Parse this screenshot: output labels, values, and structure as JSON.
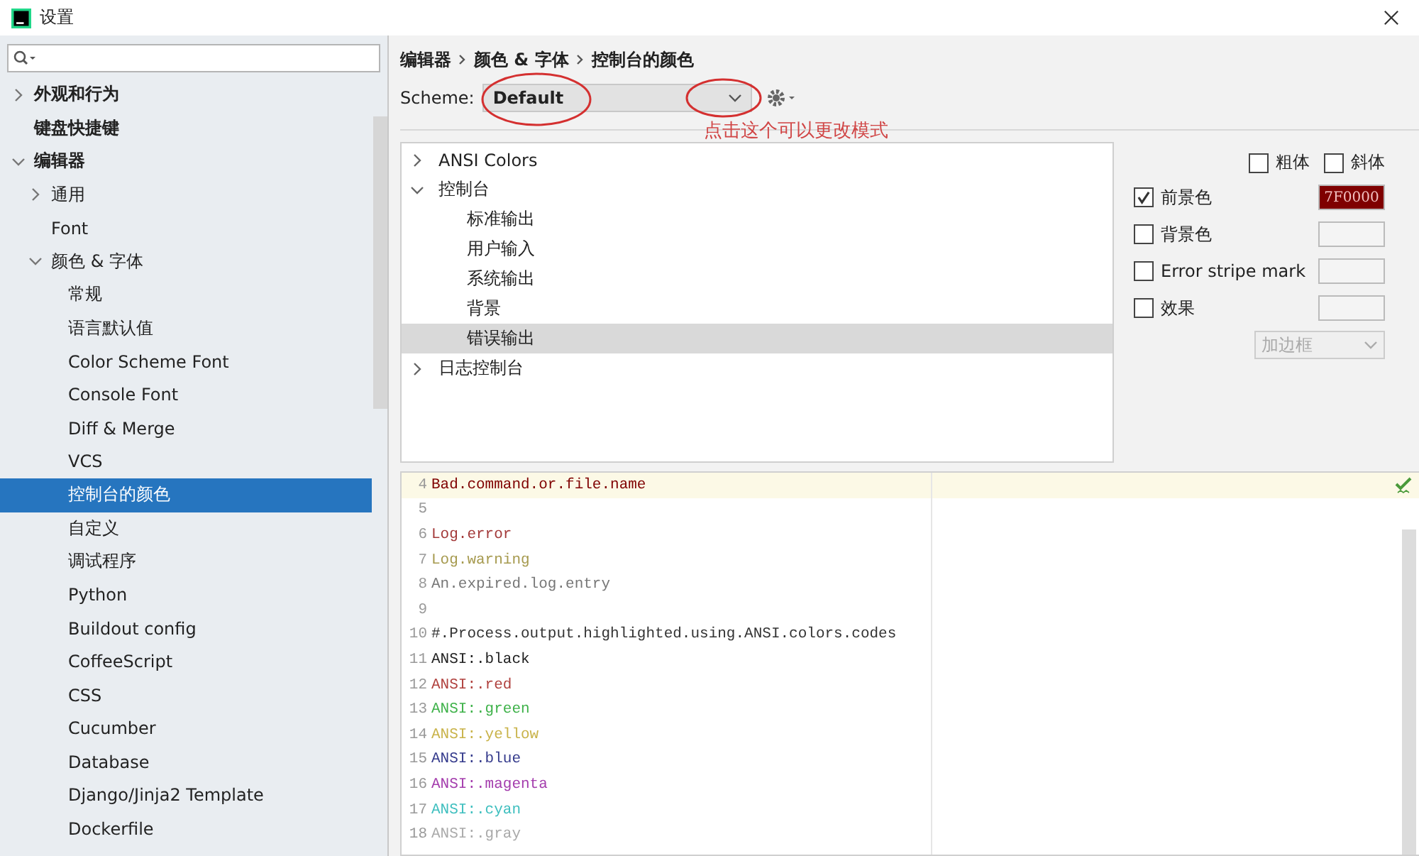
{
  "window": {
    "title": "设置"
  },
  "sidebar": {
    "items": [
      {
        "label": "外观和行为",
        "expanded": false,
        "selected": false
      },
      {
        "label": "键盘快捷键",
        "selected": false
      },
      {
        "label": "编辑器",
        "expanded": true,
        "selected": false,
        "children": [
          {
            "label": "通用",
            "expanded": false,
            "selected": false
          },
          {
            "label": "Font",
            "selected": false
          },
          {
            "label": "颜色 & 字体",
            "expanded": true,
            "selected": false,
            "children": [
              {
                "label": "常规",
                "selected": false
              },
              {
                "label": "语言默认值",
                "selected": false
              },
              {
                "label": "Color Scheme Font",
                "selected": false
              },
              {
                "label": "Console Font",
                "selected": false
              },
              {
                "label": "Diff & Merge",
                "selected": false
              },
              {
                "label": "VCS",
                "selected": false
              },
              {
                "label": "控制台的颜色",
                "selected": true
              },
              {
                "label": "自定义",
                "selected": false
              },
              {
                "label": "调试程序",
                "selected": false
              },
              {
                "label": "Python",
                "selected": false
              },
              {
                "label": "Buildout config",
                "selected": false
              },
              {
                "label": "CoffeeScript",
                "selected": false
              },
              {
                "label": "CSS",
                "selected": false
              },
              {
                "label": "Cucumber",
                "selected": false
              },
              {
                "label": "Database",
                "selected": false
              },
              {
                "label": "Django/Jinja2 Template",
                "selected": false
              },
              {
                "label": "Dockerfile",
                "selected": false
              }
            ]
          }
        ]
      }
    ]
  },
  "breadcrumb": [
    "编辑器",
    "颜色 & 字体",
    "控制台的颜色"
  ],
  "scheme": {
    "label": "Scheme:",
    "value": "Default"
  },
  "annotation": {
    "text": "点击这个可以更改模式"
  },
  "categories": [
    {
      "label": "ANSI Colors",
      "expanded": false,
      "selected": false
    },
    {
      "label": "控制台",
      "expanded": true,
      "selected": false,
      "children": [
        {
          "label": "标准输出",
          "selected": false
        },
        {
          "label": "用户输入",
          "selected": false
        },
        {
          "label": "系统输出",
          "selected": false
        },
        {
          "label": "背景",
          "selected": false
        },
        {
          "label": "错误输出",
          "selected": true
        }
      ]
    },
    {
      "label": "日志控制台",
      "expanded": false,
      "selected": false
    }
  ],
  "font_style": [
    {
      "label": "粗体",
      "checked": false
    },
    {
      "label": "斜体",
      "checked": false
    }
  ],
  "attributes": [
    {
      "label": "前景色",
      "checked": true,
      "value": "7F0000",
      "color": "#7f0000"
    },
    {
      "label": "背景色",
      "checked": false
    },
    {
      "label": "Error stripe mark",
      "checked": false
    },
    {
      "label": "效果",
      "checked": false
    }
  ],
  "effect_dropdown": {
    "value": "加边框",
    "disabled": true
  },
  "preview": {
    "lines": [
      {
        "number": "4",
        "text": "Bad.command.or.file.name",
        "color": "#7f0000",
        "current": true
      },
      {
        "number": "5",
        "current": false
      },
      {
        "number": "6",
        "text": "Log.error",
        "color": "#a33a3a",
        "current": false
      },
      {
        "number": "7",
        "text": "Log.warning",
        "color": "#a69a4f",
        "current": false
      },
      {
        "number": "8",
        "text": "An.expired.log.entry",
        "color": "#777777",
        "current": false
      },
      {
        "number": "9",
        "current": false
      },
      {
        "number": "10",
        "text": "#.Process.output.highlighted.using.ANSI.colors.codes",
        "color": "#333333",
        "current": false
      },
      {
        "number": "11",
        "text": "ANSI:.black",
        "color": "#222222",
        "current": false
      },
      {
        "number": "12",
        "text": "ANSI:.red",
        "color": "#b0413e",
        "current": false
      },
      {
        "number": "13",
        "text": "ANSI:.green",
        "color": "#3fb24a",
        "current": false
      },
      {
        "number": "14",
        "text": "ANSI:.yellow",
        "color": "#c9b34a",
        "current": false
      },
      {
        "number": "15",
        "text": "ANSI:.blue",
        "color": "#353b8c",
        "current": false
      },
      {
        "number": "16",
        "text": "ANSI:.magenta",
        "color": "#a43dad",
        "current": false
      },
      {
        "number": "17",
        "text": "ANSI:.cyan",
        "color": "#3fbfbf",
        "current": false
      },
      {
        "number": "18",
        "text": "ANSI:.gray",
        "color": "#aaaaaa",
        "current": false
      }
    ]
  }
}
